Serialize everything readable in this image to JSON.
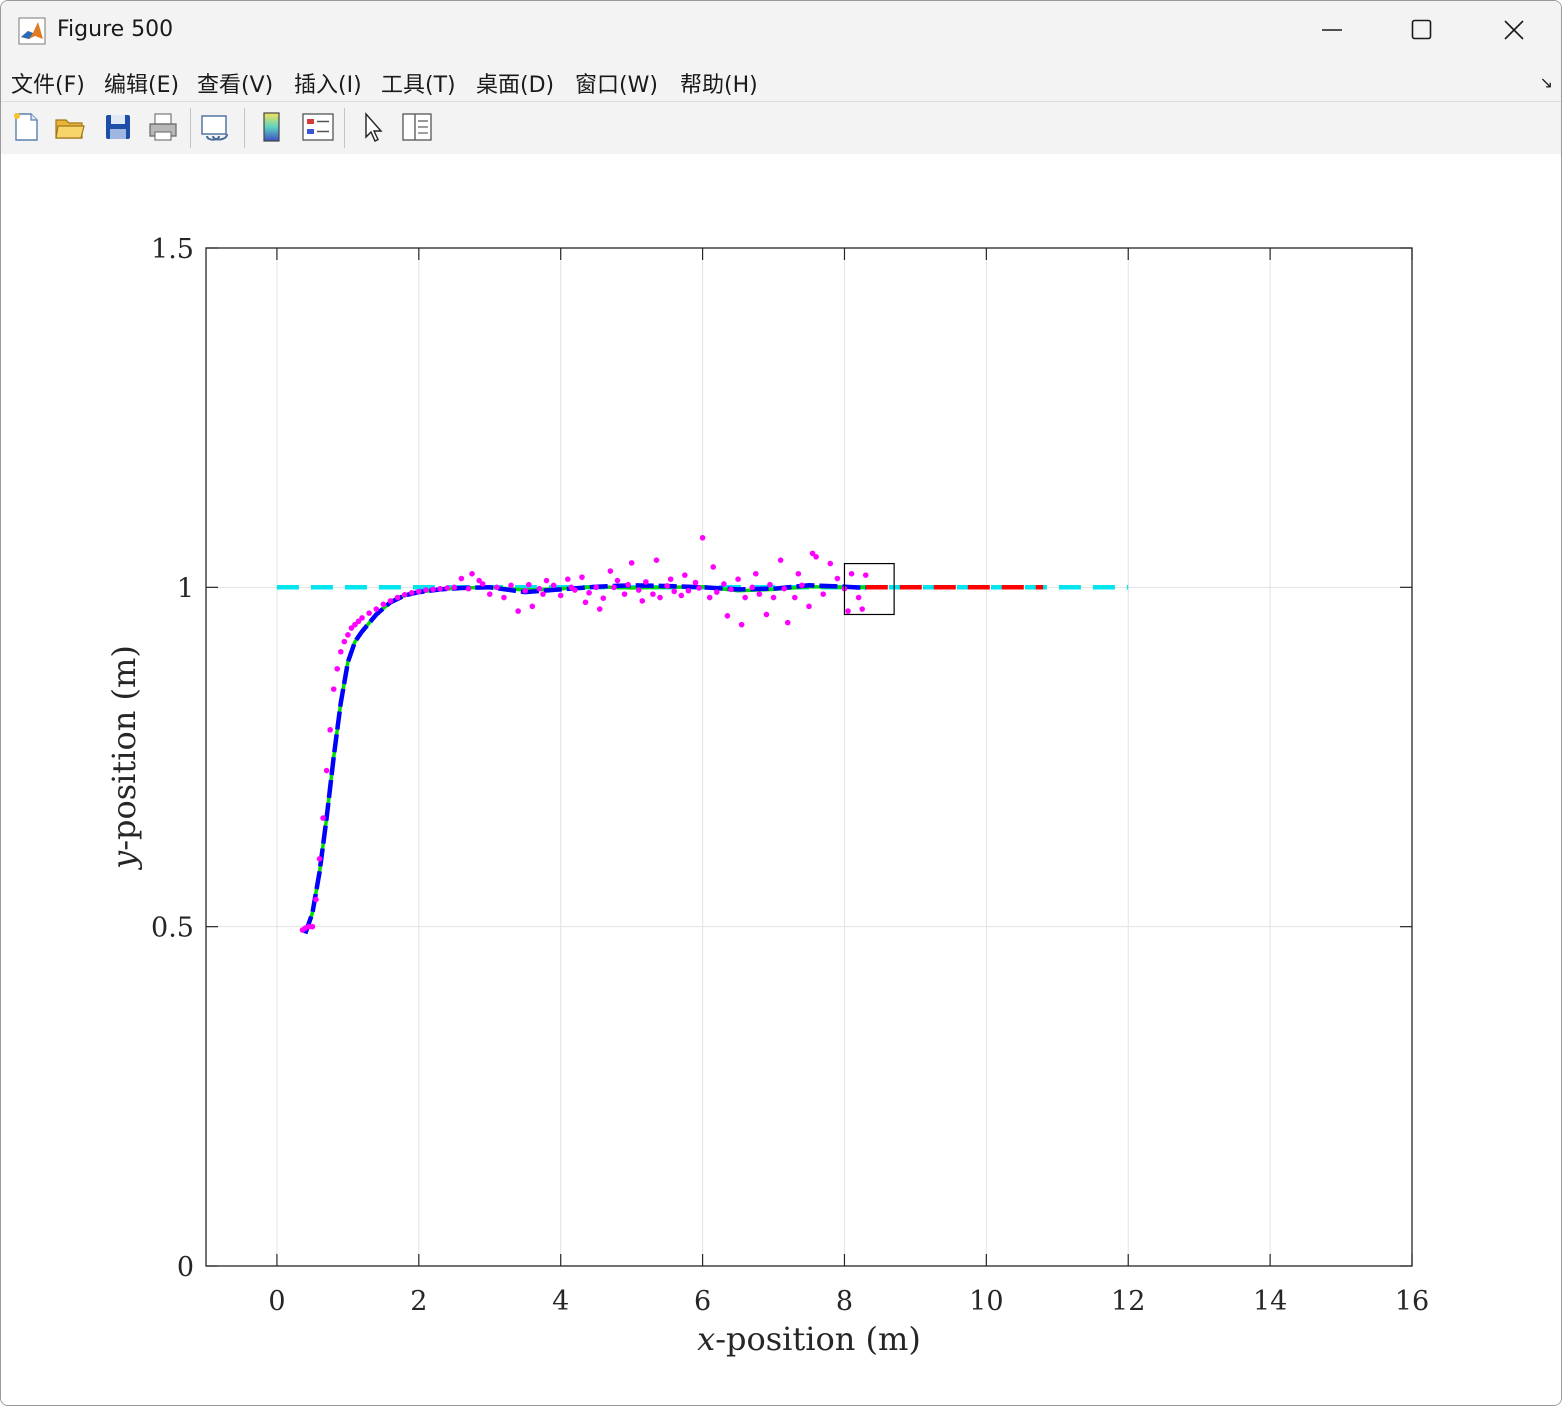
{
  "window": {
    "title": "Figure 500",
    "controls": [
      "minimize",
      "maximize",
      "close"
    ]
  },
  "menu": [
    "文件(F)",
    "编辑(E)",
    "查看(V)",
    "插入(I)",
    "工具(T)",
    "桌面(D)",
    "窗口(W)",
    "帮助(H)"
  ],
  "menu_corner": "↘",
  "toolbar": [
    "new-figure-icon",
    "open-file-icon",
    "save-icon",
    "print-icon",
    "link-plot-icon",
    "colorbar-icon",
    "legend-icon",
    "pointer-icon",
    "property-inspector-icon"
  ],
  "chart_data": {
    "type": "line",
    "xlabel_var": "x",
    "xlabel_rest": "-position (m)",
    "ylabel_var": "y",
    "ylabel_rest": "-position (m)",
    "xlim": [
      -1,
      16
    ],
    "ylim": [
      0,
      1.5
    ],
    "xticks": [
      0,
      2,
      4,
      6,
      8,
      10,
      12,
      14,
      16
    ],
    "yticks": [
      0,
      0.5,
      1,
      1.5
    ],
    "xtick_labels": [
      "0",
      "2",
      "4",
      "6",
      "8",
      "10",
      "12",
      "14",
      "16"
    ],
    "ytick_labels": [
      "0",
      "0.5",
      "1",
      "1.5"
    ],
    "grid": true,
    "series": [
      {
        "style": "dashed",
        "color": "#00e5ee",
        "x": [
          0,
          12
        ],
        "y": [
          1,
          1
        ]
      },
      {
        "style": "dashed",
        "color": "#ff0000",
        "x": [
          8.3,
          10.8
        ],
        "y": [
          1,
          1
        ]
      },
      {
        "style": "solid",
        "color": "#00dd00",
        "x": [
          0.4,
          0.5,
          0.6,
          0.7,
          0.8,
          0.9,
          1.0,
          1.1,
          1.2,
          1.4,
          1.6,
          1.8,
          2.0,
          2.3,
          2.6,
          3.0,
          3.5,
          4.0,
          4.5,
          5.0,
          5.5,
          6.0,
          6.5,
          7.0,
          7.5,
          8.0,
          8.3
        ],
        "y": [
          0.49,
          0.52,
          0.58,
          0.66,
          0.75,
          0.83,
          0.89,
          0.92,
          0.935,
          0.96,
          0.978,
          0.988,
          0.993,
          0.997,
          0.999,
          1.0,
          0.996,
          0.998,
          1.001,
          0.999,
          1.0,
          1.001,
          0.995,
          0.997,
          1.001,
          1.0,
          1.0
        ]
      },
      {
        "style": "dashed-thick",
        "color": "#0000ff",
        "x": [
          0.4,
          0.5,
          0.6,
          0.7,
          0.8,
          0.9,
          1.0,
          1.1,
          1.2,
          1.4,
          1.6,
          1.8,
          2.0,
          2.3,
          2.6,
          3.0,
          3.5,
          4.0,
          4.5,
          5.0,
          5.5,
          6.0,
          6.5,
          7.0,
          7.5,
          8.0,
          8.3
        ],
        "y": [
          0.49,
          0.52,
          0.58,
          0.66,
          0.75,
          0.83,
          0.89,
          0.92,
          0.935,
          0.96,
          0.978,
          0.988,
          0.993,
          0.997,
          0.999,
          1.0,
          0.993,
          0.997,
          1.001,
          1.003,
          1.002,
          1.0,
          0.997,
          0.998,
          1.003,
          1.001,
          0.999
        ]
      }
    ],
    "measurements": {
      "color": "#ff00ff",
      "x": [
        0.36,
        0.4,
        0.45,
        0.5,
        0.55,
        0.6,
        0.65,
        0.7,
        0.75,
        0.8,
        0.85,
        0.9,
        0.95,
        1.0,
        1.05,
        1.1,
        1.15,
        1.2,
        1.3,
        1.4,
        1.5,
        1.6,
        1.7,
        1.8,
        1.9,
        2.0,
        2.1,
        2.2,
        2.3,
        2.4,
        2.5,
        2.6,
        2.7,
        2.75,
        2.85,
        2.9,
        3.0,
        3.1,
        3.2,
        3.3,
        3.4,
        3.5,
        3.55,
        3.6,
        3.7,
        3.75,
        3.8,
        3.9,
        4.0,
        4.1,
        4.15,
        4.2,
        4.3,
        4.35,
        4.4,
        4.5,
        4.55,
        4.6,
        4.7,
        4.75,
        4.8,
        4.9,
        4.95,
        5.0,
        5.1,
        5.15,
        5.2,
        5.3,
        5.35,
        5.4,
        5.5,
        5.55,
        5.6,
        5.7,
        5.75,
        5.8,
        5.9,
        5.95,
        6.0,
        6.1,
        6.15,
        6.2,
        6.3,
        6.35,
        6.4,
        6.5,
        6.55,
        6.6,
        6.7,
        6.75,
        6.8,
        6.9,
        6.95,
        7.0,
        7.1,
        7.15,
        7.2,
        7.3,
        7.35,
        7.4,
        7.5,
        7.55,
        7.6,
        7.7,
        7.8,
        7.9,
        8.0,
        8.05,
        8.1,
        8.2,
        8.25,
        8.3
      ],
      "y": [
        0.495,
        0.498,
        0.5,
        0.5,
        0.54,
        0.6,
        0.66,
        0.73,
        0.79,
        0.85,
        0.88,
        0.905,
        0.92,
        0.93,
        0.94,
        0.945,
        0.95,
        0.955,
        0.962,
        0.968,
        0.975,
        0.98,
        0.985,
        0.989,
        0.992,
        0.994,
        0.996,
        0.997,
        0.998,
        0.999,
        1.0,
        1.013,
        0.998,
        1.02,
        1.01,
        1.005,
        0.99,
        1.0,
        0.985,
        1.003,
        0.965,
        0.995,
        1.004,
        0.972,
        0.998,
        0.99,
        1.01,
        1.003,
        0.988,
        1.012,
        1.0,
        0.996,
        1.015,
        0.978,
        0.992,
        1.0,
        0.968,
        0.984,
        1.024,
        1.0,
        1.01,
        0.99,
        1.004,
        1.036,
        0.996,
        0.98,
        1.008,
        0.99,
        1.04,
        0.985,
        1.002,
        1.012,
        0.994,
        0.988,
        1.018,
        0.995,
        1.007,
        0.999,
        1.073,
        0.985,
        1.03,
        0.993,
        1.005,
        0.958,
        0.997,
        1.012,
        0.945,
        0.985,
        1.0,
        1.02,
        0.99,
        0.96,
        1.004,
        0.985,
        1.04,
        0.998,
        0.948,
        0.985,
        1.02,
        1.003,
        0.972,
        1.05,
        1.045,
        0.99,
        1.035,
        1.013,
        0.998,
        0.965,
        1.02,
        0.985,
        0.968,
        1.018
      ]
    },
    "zoom_box": {
      "x": [
        8.0,
        8.7
      ],
      "y": [
        0.96,
        1.035
      ]
    }
  }
}
